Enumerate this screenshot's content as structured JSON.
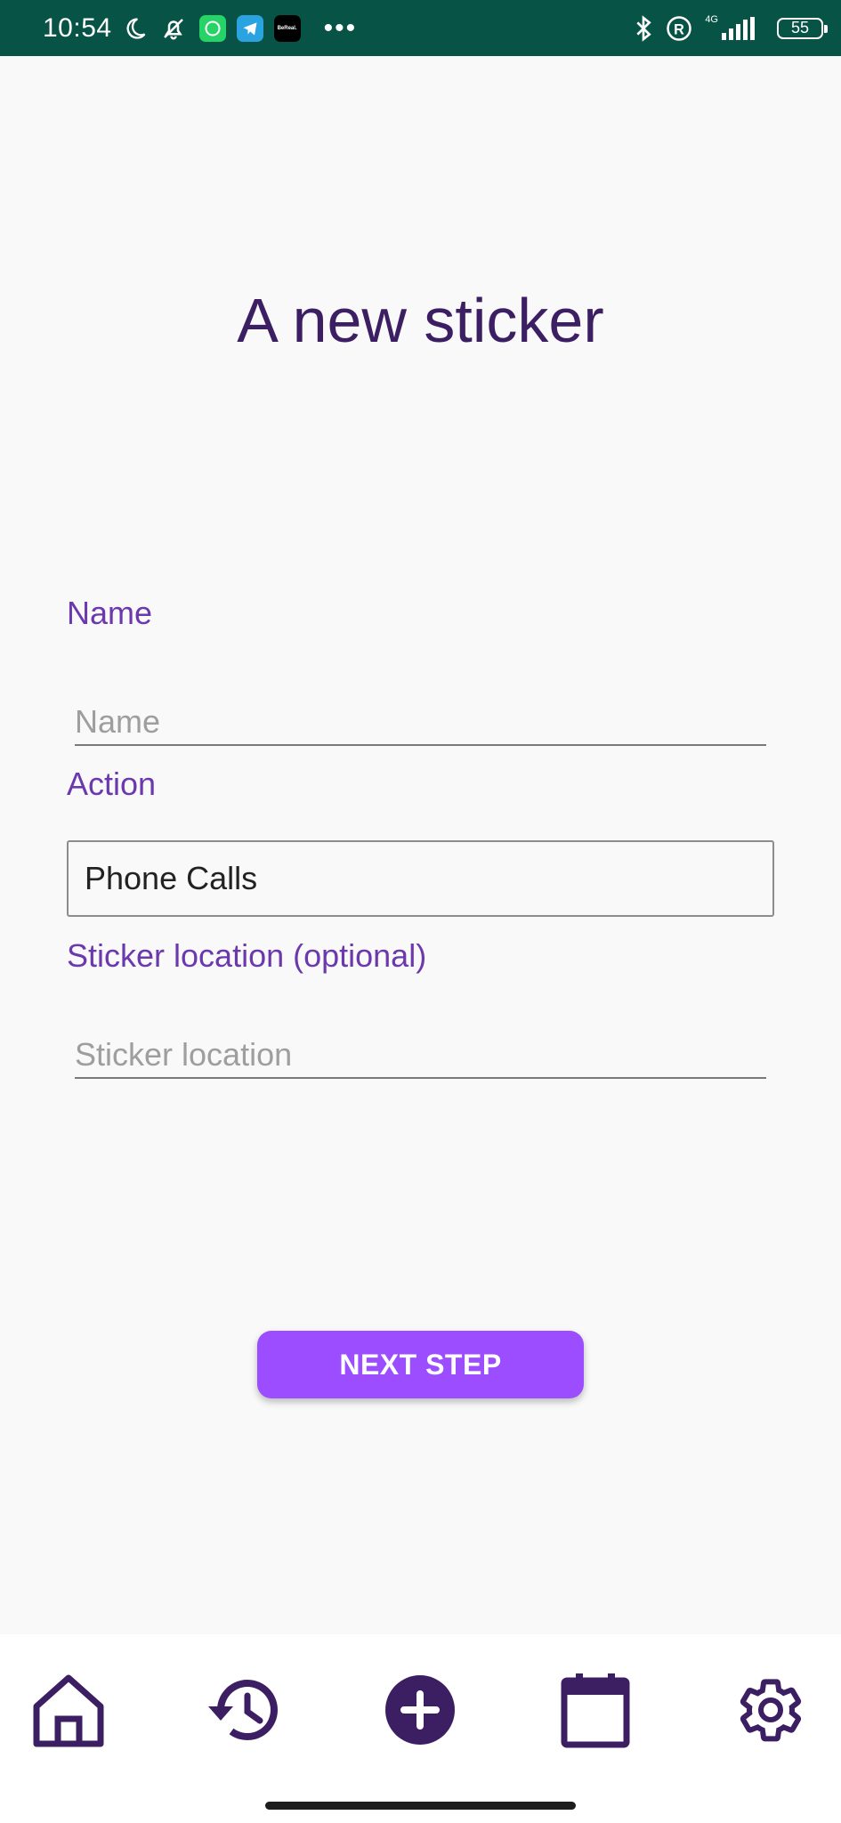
{
  "status_bar": {
    "time": "10:54",
    "network": "4G",
    "battery": "55",
    "bereal_label": "BeReal."
  },
  "page": {
    "title": "A new sticker"
  },
  "form": {
    "name_label": "Name",
    "name_placeholder": "Name",
    "name_value": "",
    "action_label": "Action",
    "action_value": "Phone Calls",
    "location_label": "Sticker location (optional)",
    "location_placeholder": "Sticker location",
    "location_value": "",
    "next_button": "NEXT STEP"
  },
  "nav": {
    "items": [
      {
        "icon": "home-icon"
      },
      {
        "icon": "history-icon"
      },
      {
        "icon": "add-circle-icon"
      },
      {
        "icon": "calendar-icon"
      },
      {
        "icon": "settings-icon"
      }
    ]
  },
  "colors": {
    "status_bar": "#075346",
    "title": "#3c1f63",
    "label": "#6b38ad",
    "button": "#9b4dff",
    "nav_icon": "#3c1f63"
  }
}
